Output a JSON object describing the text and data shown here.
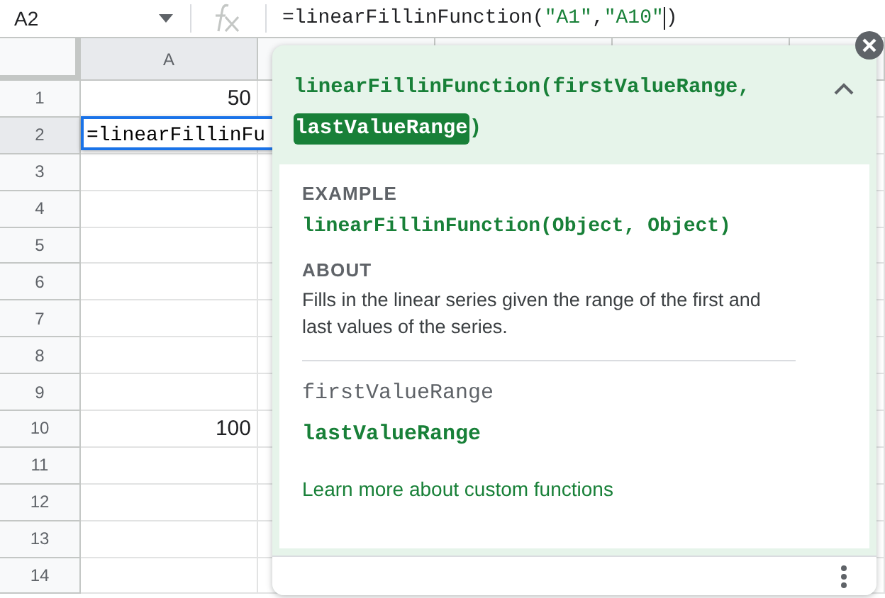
{
  "name_box": {
    "value": "A2"
  },
  "formula_bar": {
    "segments": [
      {
        "kind": "plain",
        "text": "=linearFillinFunction("
      },
      {
        "kind": "string",
        "text": "\"A1\""
      },
      {
        "kind": "plain",
        "text": ","
      },
      {
        "kind": "string",
        "text": "\"A10\""
      },
      {
        "kind": "cursor"
      },
      {
        "kind": "plain",
        "text": ")"
      }
    ]
  },
  "columns": [
    {
      "label": "A",
      "selected": true
    }
  ],
  "rows": [
    {
      "number": "1",
      "selected": false,
      "value": "50"
    },
    {
      "number": "2",
      "selected": true,
      "editing": true,
      "value": "=linearFillinFu"
    },
    {
      "number": "3",
      "selected": false
    },
    {
      "number": "4",
      "selected": false
    },
    {
      "number": "5",
      "selected": false
    },
    {
      "number": "6",
      "selected": false
    },
    {
      "number": "7",
      "selected": false
    },
    {
      "number": "8",
      "selected": false
    },
    {
      "number": "9",
      "selected": false
    },
    {
      "number": "10",
      "selected": false,
      "value": "100"
    },
    {
      "number": "11",
      "selected": false
    },
    {
      "number": "12",
      "selected": false
    },
    {
      "number": "13",
      "selected": false
    },
    {
      "number": "14",
      "selected": false
    }
  ],
  "help_popup": {
    "expanded": true,
    "signature": [
      {
        "text": "linearFillinFunction(firstValueRange, ",
        "active": false
      },
      {
        "text": "lastValueRange",
        "active": true
      },
      {
        "text": ")",
        "active": false
      }
    ],
    "sections": [
      {
        "heading": "EXAMPLE",
        "kind": "code",
        "text": "linearFillinFunction(Object, Object)"
      },
      {
        "heading": "ABOUT",
        "kind": "prose",
        "text": "Fills in the linear series given the range of the first and last values of the series."
      }
    ],
    "params": [
      {
        "text": "firstValueRange",
        "active": false
      },
      {
        "text": "lastValueRange",
        "active": true
      }
    ],
    "link": "Learn more about custom functions"
  }
}
